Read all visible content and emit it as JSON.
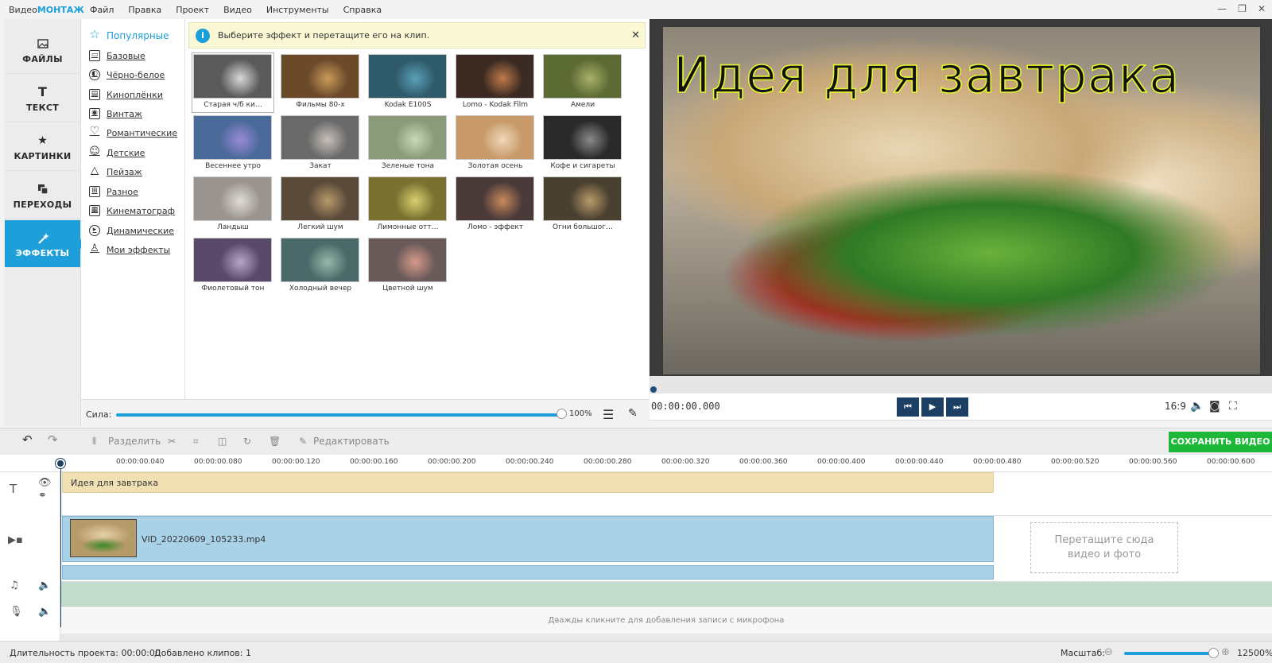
{
  "app": {
    "logo_pre": "Видео",
    "logo_brand": "МОНТАЖ"
  },
  "menu": [
    "Файл",
    "Правка",
    "Проект",
    "Видео",
    "Инструменты",
    "Справка"
  ],
  "window_buttons": [
    "—",
    "❐",
    "✕"
  ],
  "leftnav": [
    {
      "label": "ФАЙЛЫ",
      "icon": "image-icon"
    },
    {
      "label": "ТЕКСТ",
      "icon": "text-icon"
    },
    {
      "label": "КАРТИНКИ",
      "icon": "star-icon"
    },
    {
      "label": "ПЕРЕХОДЫ",
      "icon": "transition-icon"
    },
    {
      "label": "ЭФФЕКТЫ",
      "icon": "magic-wand-icon",
      "active": true
    }
  ],
  "categories": [
    "Популярные",
    "Базовые",
    "Чёрно-белое",
    "Киноплёнки",
    "Винтаж",
    "Романтические",
    "Детские",
    "Пейзаж",
    "Разное",
    "Кинематограф",
    "Динамические",
    "Мои эффекты"
  ],
  "hint": "Выберите эффект и перетащите его на клип.",
  "effects": [
    "Старая ч/б ки…",
    "Фильмы 80-х",
    "Kodak E100S",
    "Lomo - Kodak Film",
    "Амели",
    "Весеннее утро",
    "Закат",
    "Зеленые тона",
    "Золотая осень",
    "Кофе и сигареты",
    "Ландыш",
    "Легкий шум",
    "Лимонные отт…",
    "Ломо - эффект",
    "Огни большог…",
    "Фиолетовый тон",
    "Холодный вечер",
    "Цветной шум"
  ],
  "strength": {
    "label": "Сила:",
    "value": "100%",
    "level": 1.0
  },
  "preview": {
    "title": "Идея для завтрака",
    "timecode": "00:00:00.000",
    "aspect": "16:9"
  },
  "toolbar": {
    "split": "Разделить",
    "edit": "Редактировать",
    "save": "СОХРАНИТЬ ВИДЕО"
  },
  "ruler": [
    "00:00:00.040",
    "00:00:00.080",
    "00:00:00.120",
    "00:00:00.160",
    "00:00:00.200",
    "00:00:00.240",
    "00:00:00.280",
    "00:00:00.320",
    "00:00:00.360",
    "00:00:00.400",
    "00:00:00.440",
    "00:00:00.480",
    "00:00:00.520",
    "00:00:00.560",
    "00:00:00.600"
  ],
  "timeline": {
    "text_clip": "Идея для завтрака",
    "video_clip": "VID_20220609_105233.mp4",
    "dropzone_line1": "Перетащите сюда",
    "dropzone_line2": "видео и фото",
    "mic_hint": "Дважды кликните для добавления записи с микрофона"
  },
  "status": {
    "duration": "Длительность проекта:  00:00:00",
    "clips": "Добавлено клипов: 1",
    "zoom_label": "Масштаб:",
    "zoom_value": "12500%"
  },
  "colors": {
    "accent": "#1f9fd9",
    "save": "#1db837",
    "text_clip": "#f1e0b4",
    "video_clip": "#a9d2e9",
    "audio_track": "#c4dccb",
    "title_stroke": "#e5f52e"
  }
}
